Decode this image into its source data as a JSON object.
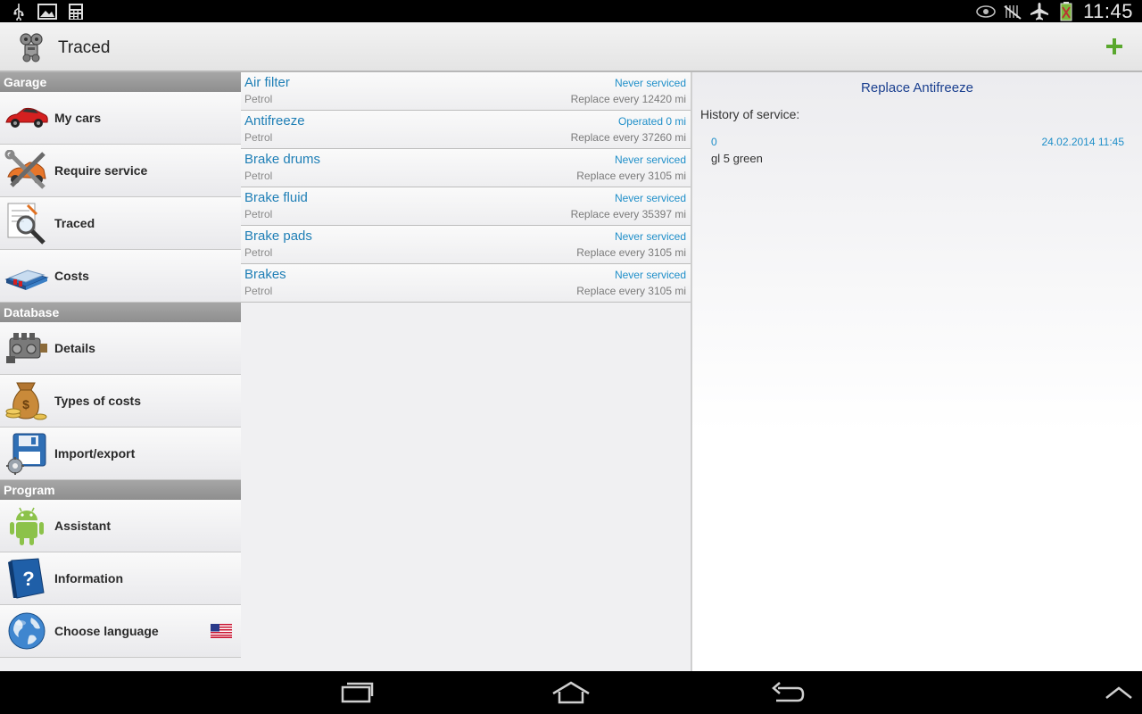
{
  "status_bar": {
    "time": "11:45",
    "left_icons": [
      "usb-icon",
      "image-icon",
      "calculator-icon"
    ],
    "right_icons": [
      "eye-icon",
      "mute-icon",
      "airplane-icon",
      "battery-icon"
    ]
  },
  "action_bar": {
    "title": "Traced",
    "add_label": "+"
  },
  "sidebar": {
    "sections": [
      {
        "header": "Garage",
        "items": [
          {
            "label": "My cars",
            "icon": "car-icon"
          },
          {
            "label": "Require service",
            "icon": "tools-icon"
          },
          {
            "label": "Traced",
            "icon": "magnifier-icon"
          },
          {
            "label": "Costs",
            "icon": "cash-icon"
          }
        ]
      },
      {
        "header": "Database",
        "items": [
          {
            "label": "Details",
            "icon": "engine-icon"
          },
          {
            "label": "Types of costs",
            "icon": "money-bag-icon"
          },
          {
            "label": "Import/export",
            "icon": "floppy-icon"
          }
        ]
      },
      {
        "header": "Program",
        "items": [
          {
            "label": "Assistant",
            "icon": "android-icon"
          },
          {
            "label": "Information",
            "icon": "help-book-icon"
          },
          {
            "label": "Choose language",
            "icon": "globe-icon"
          }
        ]
      }
    ]
  },
  "list": {
    "rows": [
      {
        "title": "Air filter",
        "fuel": "Petrol",
        "status": "Never serviced",
        "interval": "Replace every 12420 mi"
      },
      {
        "title": "Antifreeze",
        "fuel": "Petrol",
        "status": "Operated 0 mi",
        "interval": "Replace every 37260 mi"
      },
      {
        "title": "Brake drums",
        "fuel": "Petrol",
        "status": "Never serviced",
        "interval": "Replace every 3105 mi"
      },
      {
        "title": "Brake fluid",
        "fuel": "Petrol",
        "status": "Never serviced",
        "interval": "Replace every 35397 mi"
      },
      {
        "title": "Brake pads",
        "fuel": "Petrol",
        "status": "Never serviced",
        "interval": "Replace every 3105 mi"
      },
      {
        "title": "Brakes",
        "fuel": "Petrol",
        "status": "Never serviced",
        "interval": "Replace every 3105 mi"
      }
    ]
  },
  "detail": {
    "title": "Replace Antifreeze",
    "history_label": "History of service:",
    "history": [
      {
        "mileage": "0",
        "date": "24.02.2014 11:45",
        "note": "gl 5 green"
      }
    ]
  },
  "colors": {
    "link_blue": "#1f7fb6",
    "status_blue": "#1f8fc9",
    "title_navy": "#1a3f8f",
    "accent_green": "#5aa82e",
    "section_gray": "#9a9a9a"
  }
}
